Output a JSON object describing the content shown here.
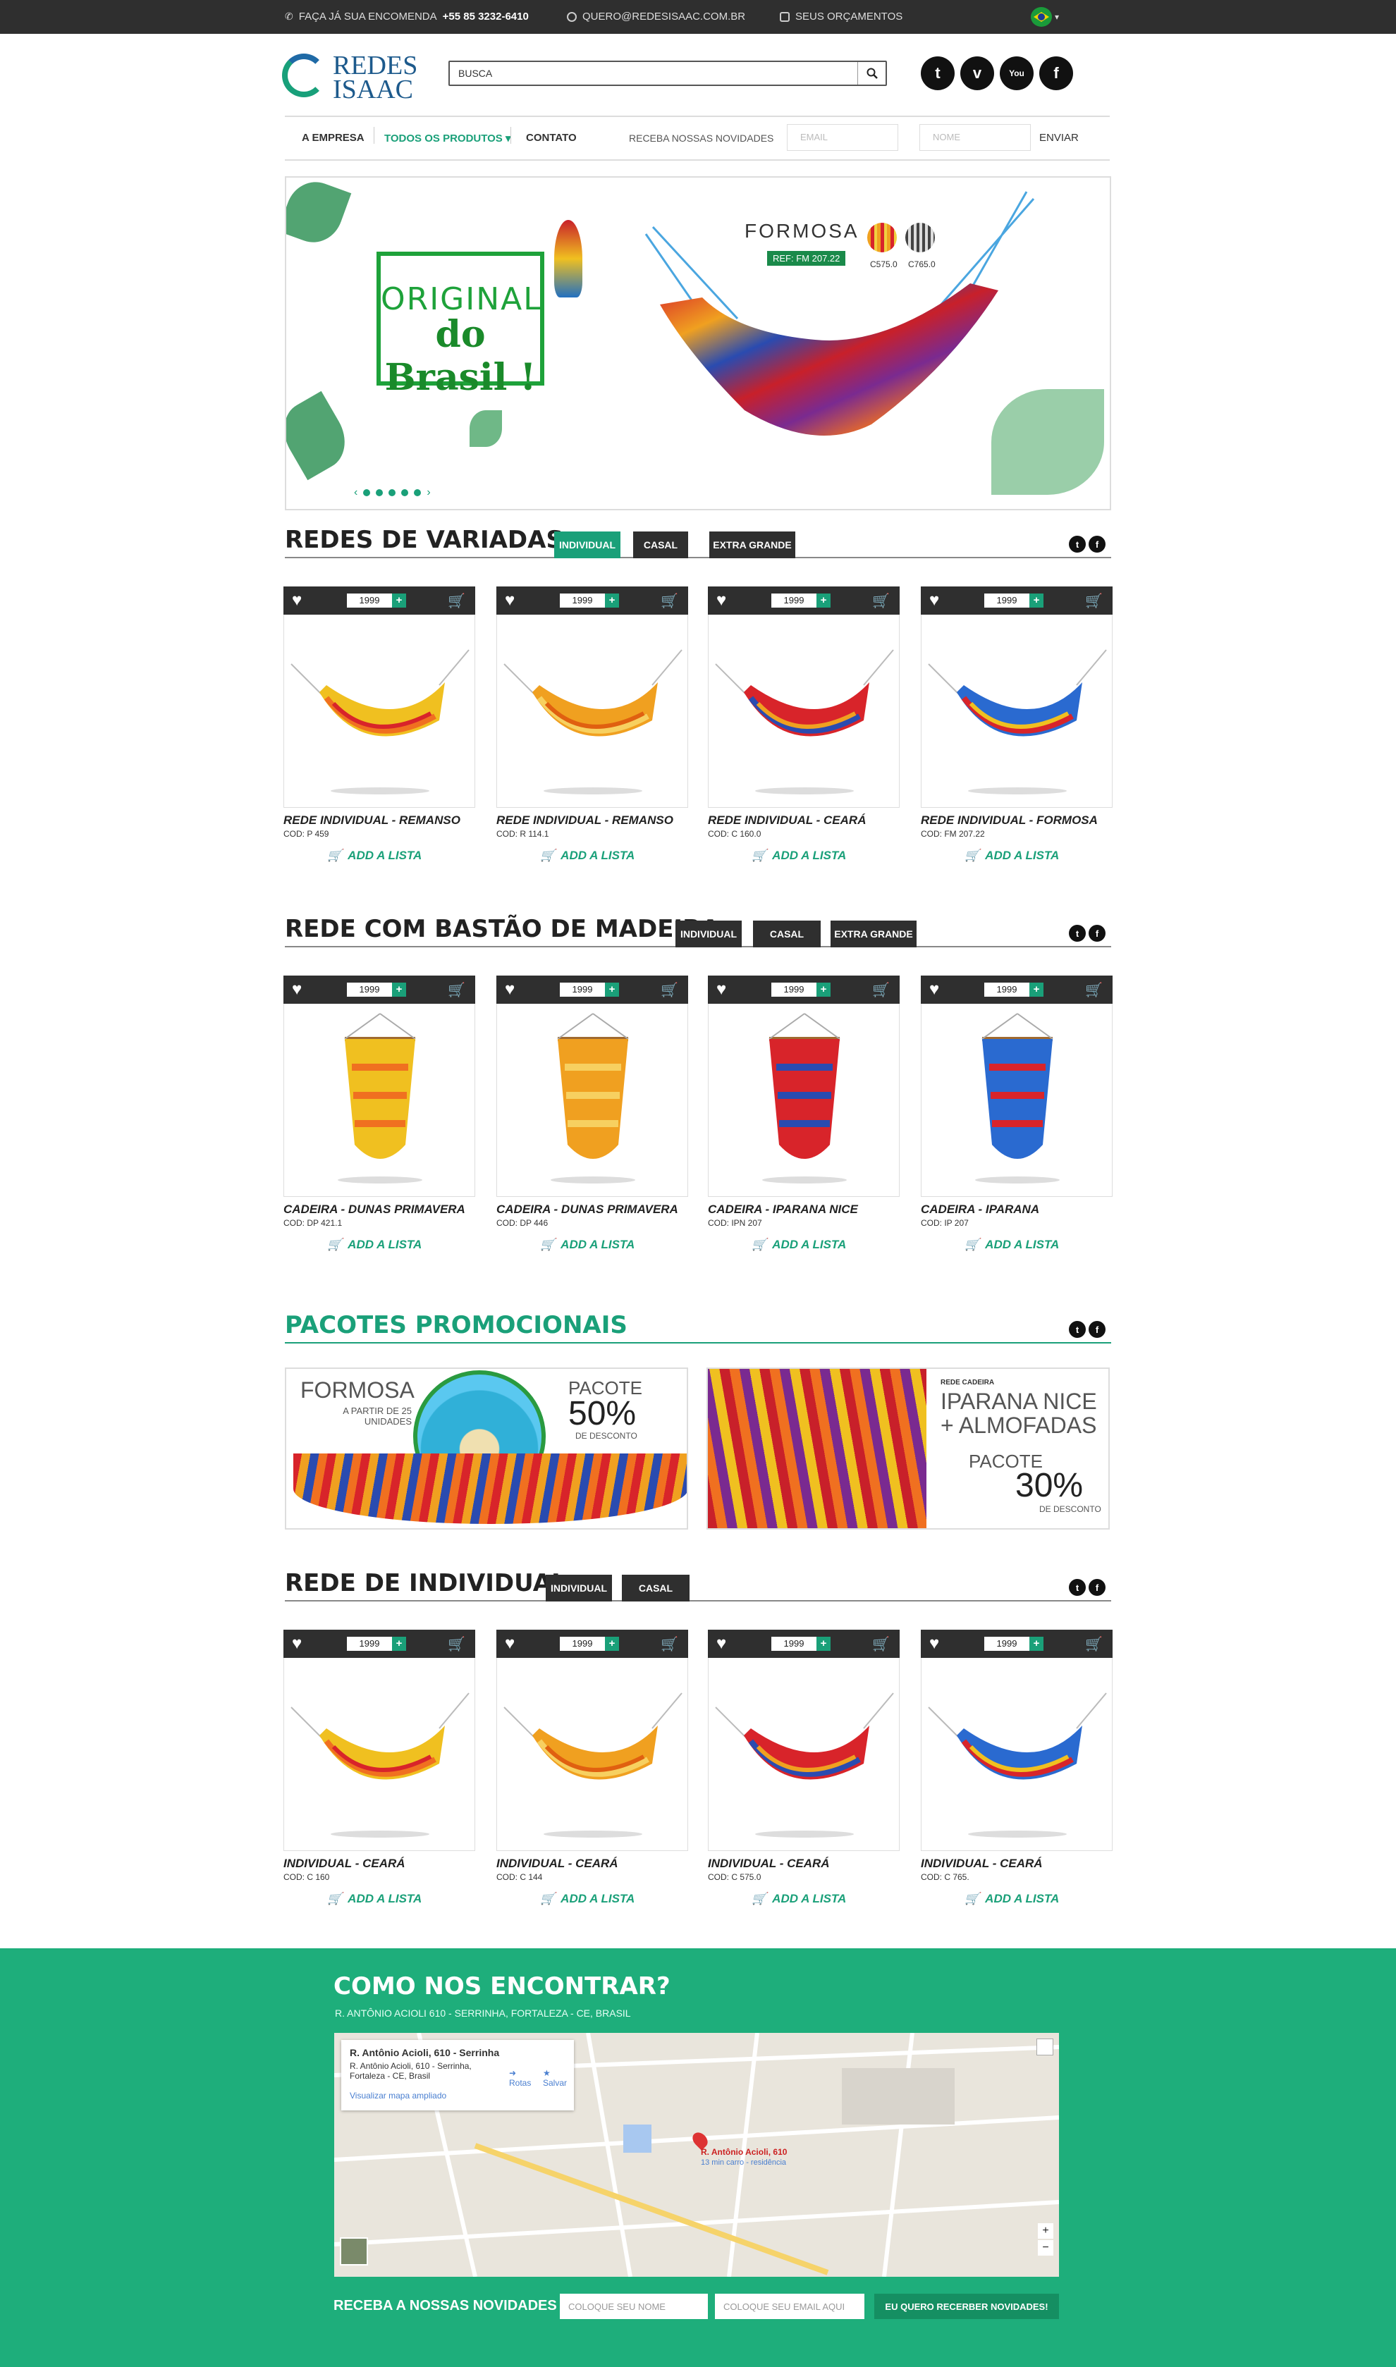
{
  "topbar": {
    "phone_prefix": "FAÇA JÁ SUA ENCOMENDA",
    "phone": "+55 85 3232-6410",
    "email": "QUERO@REDESISAAC.COM.BR",
    "quotes": "SEUS ORÇAMENTOS"
  },
  "brand": {
    "line1": "REDES",
    "line2": "ISAAC"
  },
  "search": {
    "placeholder": "BUSCA"
  },
  "social": {
    "twitter": "t",
    "vimeo": "v",
    "youtube": "You",
    "facebook": "f"
  },
  "nav": {
    "about": "A EMPRESA",
    "products": "TODOS OS PRODUTOS ▾",
    "contact": "CONTATO",
    "newsletter_label": "RECEBA NOSSAS NOVIDADES",
    "email_placeholder": "EMAIL",
    "name_placeholder": "NOME",
    "send": "ENVIAR"
  },
  "banner": {
    "badge_line1": "ORIGINAL",
    "badge_line2": "do Brasil !",
    "product": "FORMOSA",
    "ref": "REF: FM 207.22",
    "swatch1": "C575.0",
    "swatch2": "C765.0",
    "colors": {
      "accent": "#1aa079",
      "dark": "#2f2f2f"
    }
  },
  "sections": {
    "s1": {
      "title": "REDES DE VARIADAS",
      "tabs": [
        "INDIVIDUAL",
        "CASAL",
        "EXTRA GRANDE"
      ]
    },
    "s2": {
      "title": "REDE COM BASTÃO DE MADEIRA",
      "tabs": [
        "INDIVIDUAL",
        "CASAL",
        "EXTRA GRANDE"
      ]
    },
    "s3": {
      "title": "PACOTES PROMOCIONAIS"
    },
    "s4": {
      "title": "REDE DE INDIVIDUAL",
      "tabs": [
        "INDIVIDUAL",
        "CASAL"
      ]
    }
  },
  "card_common": {
    "qty": "1999",
    "plus": "+",
    "add": "ADD A LISTA"
  },
  "products1": [
    {
      "name": "REDE INDIVIDUAL - REMANSO",
      "code": "COD: P 459"
    },
    {
      "name": "REDE INDIVIDUAL - REMANSO",
      "code": "COD: R 114.1"
    },
    {
      "name": "REDE INDIVIDUAL - CEARÁ",
      "code": "COD: C 160.0"
    },
    {
      "name": "REDE INDIVIDUAL - FORMOSA",
      "code": "COD: FM 207.22"
    }
  ],
  "products2": [
    {
      "name": "CADEIRA - DUNAS PRIMAVERA",
      "code": "COD: DP 421.1"
    },
    {
      "name": "CADEIRA - DUNAS PRIMAVERA",
      "code": "COD: DP 446"
    },
    {
      "name": "CADEIRA - IPARANA NICE",
      "code": "COD: IPN 207"
    },
    {
      "name": "CADEIRA - IPARANA",
      "code": "COD: IP 207"
    }
  ],
  "products3": [
    {
      "name": "INDIVIDUAL - CEARÁ",
      "code": "COD: C 160"
    },
    {
      "name": "INDIVIDUAL - CEARÁ",
      "code": "COD: C 144"
    },
    {
      "name": "INDIVIDUAL - CEARÁ",
      "code": "COD: C 575.0"
    },
    {
      "name": "INDIVIDUAL - CEARÁ",
      "code": "COD: C 765."
    }
  ],
  "promos": {
    "p1": {
      "name": "FORMOSA",
      "sub": "A PARTIR DE 25 UNIDADES",
      "label": "PACOTE",
      "pct": "50%",
      "desc": "DE DESCONTO"
    },
    "p2": {
      "tag": "REDE CADEIRA",
      "name1": "IPARANA NICE",
      "name2": "+ ALMOFADAS",
      "label": "PACOTE",
      "pct": "30%",
      "desc": "DE DESCONTO"
    }
  },
  "footer": {
    "title": "COMO NOS ENCONTRAR?",
    "address": "R. ANTÔNIO ACIOLI 610 - SERRINHA, FORTALEZA - CE, BRASIL",
    "map": {
      "card_title": "R. Antônio Acioli, 610 - Serrinha",
      "card_addr": "R. Antônio Acioli, 610 - Serrinha, Fortaleza - CE, Brasil",
      "card_link": "Visualizar mapa ampliado",
      "routes": "Rotas",
      "save": "Salvar",
      "pin": "R. Antônio Acioli, 610",
      "pin_sub": "13 min carro - residência"
    },
    "newsletter": "RECEBA A NOSSAS NOVIDADES",
    "name_placeholder": "COLOQUE SEU NOME",
    "email_placeholder": "COLOQUE SEU EMAIL AQUI",
    "submit": "EU QUERO RECERBER NOVIDADES!"
  }
}
